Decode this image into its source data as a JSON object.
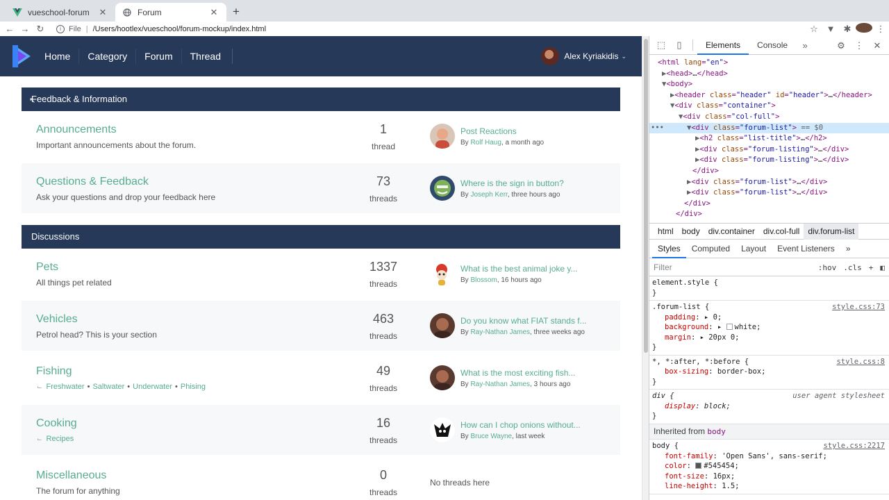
{
  "browser": {
    "tabs": [
      {
        "title": "vueschool-forum",
        "active": false
      },
      {
        "title": "Forum",
        "active": true
      }
    ],
    "address": {
      "scheme": "File",
      "url": "/Users/hootlex/vueschool/forum-mockup/index.html"
    }
  },
  "site": {
    "nav": [
      "Home",
      "Category",
      "Forum",
      "Thread"
    ],
    "user": "Alex Kyriakidis"
  },
  "sections": [
    {
      "title": "Feedback & Information",
      "forums": [
        {
          "name": "Announcements",
          "desc": "Important announcements about the forum.",
          "count": "1",
          "unit": "thread",
          "last": {
            "title": "Post Reactions",
            "by": "By ",
            "who": "Rolf Haug",
            "when": ", a month ago"
          }
        },
        {
          "name": "Questions & Feedback",
          "desc": "Ask your questions and drop your feedback here",
          "count": "73",
          "unit": "threads",
          "last": {
            "title": "Where is the sign in button?",
            "by": "By ",
            "who": "Joseph Kerr",
            "when": ", three hours ago"
          }
        }
      ]
    },
    {
      "title": "Discussions",
      "forums": [
        {
          "name": "Pets",
          "desc": "All things pet related",
          "count": "1337",
          "unit": "threads",
          "last": {
            "title": "What is the best animal joke y...",
            "by": "By ",
            "who": "Blossom",
            "when": ", 16 hours ago"
          }
        },
        {
          "name": "Vehicles",
          "desc": "Petrol head? This is your section",
          "count": "463",
          "unit": "threads",
          "last": {
            "title": "Do you know what FIAT stands f...",
            "by": "By ",
            "who": "Ray-Nathan James",
            "when": ", three weeks ago"
          }
        },
        {
          "name": "Fishing",
          "subs": [
            "Freshwater",
            "Saltwater",
            "Underwater",
            "Phising"
          ],
          "count": "49",
          "unit": "threads",
          "last": {
            "title": "What is the most exciting fish...",
            "by": "By ",
            "who": "Ray-Nathan James",
            "when": ", 3 hours ago"
          }
        },
        {
          "name": "Cooking",
          "subs": [
            "Recipes"
          ],
          "count": "16",
          "unit": "threads",
          "last": {
            "title": "How can I chop onions without...",
            "by": "By ",
            "who": "Bruce Wayne",
            "when": ", last week"
          }
        },
        {
          "name": "Miscellaneous",
          "desc": "The forum for anything",
          "count": "0",
          "unit": "threads",
          "empty": "No threads here"
        }
      ]
    }
  ],
  "devtools": {
    "tabs": [
      "Elements",
      "Console"
    ],
    "breadcrumbs": [
      "html",
      "body",
      "div.container",
      "div.col-full",
      "div.forum-list"
    ],
    "style_tabs": [
      "Styles",
      "Computed",
      "Layout",
      "Event Listeners"
    ],
    "filter_placeholder": "Filter",
    "filter_tools": [
      ":hov",
      ".cls",
      "+"
    ],
    "inherited_label": "Inherited from ",
    "inherited_target": "body",
    "colors": {
      "header": "#263959",
      "link": "#57ad8d",
      "text": "#545454"
    }
  }
}
